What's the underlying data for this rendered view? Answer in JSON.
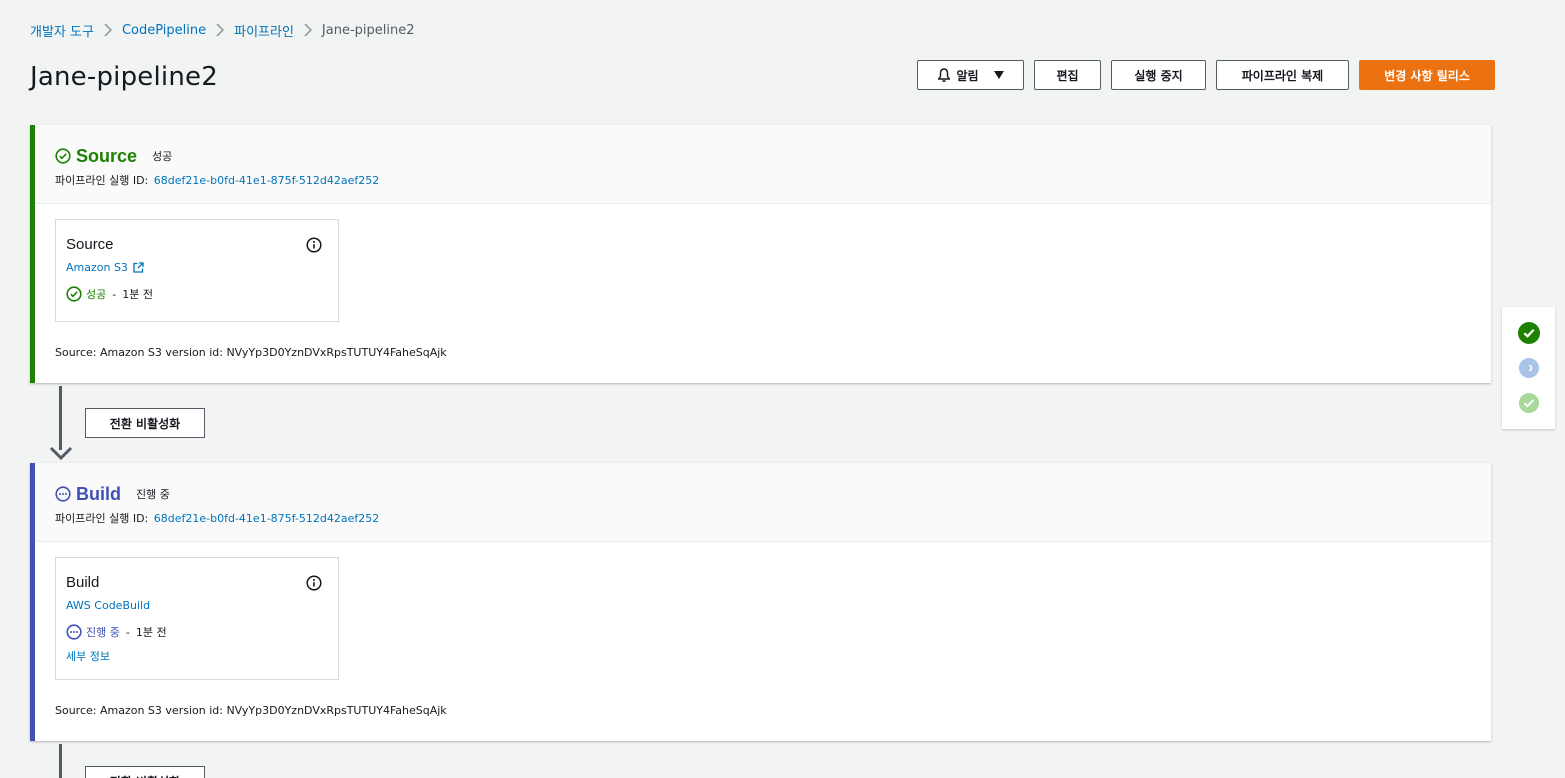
{
  "breadcrumb": {
    "items": [
      "개발자 도구",
      "CodePipeline",
      "파이프라인"
    ],
    "current": "Jane-pipeline2"
  },
  "page": {
    "title": "Jane-pipeline2"
  },
  "actions": {
    "notify": "알림",
    "edit": "편집",
    "stop": "실행 중지",
    "clone": "파이프라인 복제",
    "release": "변경 사항 릴리스"
  },
  "stages": [
    {
      "name": "Source",
      "status": "성공",
      "exec_label": "파이프라인 실행 ID:",
      "exec_id": "68def21e-b0fd-41e1-875f-512d42aef252",
      "action": {
        "name": "Source",
        "provider": "Amazon S3",
        "status": "성공",
        "time": "1분 전"
      },
      "revision": "Source: Amazon S3 version id: NVyYp3D0YznDVxRpsTUTUY4FaheSqAjk"
    },
    {
      "name": "Build",
      "status": "진행 중",
      "exec_label": "파이프라인 실행 ID:",
      "exec_id": "68def21e-b0fd-41e1-875f-512d42aef252",
      "action": {
        "name": "Build",
        "provider": "AWS CodeBuild",
        "status": "진행 중",
        "time": "1분 전",
        "details": "세부 정보"
      },
      "revision": "Source: Amazon S3 version id: NVyYp3D0YznDVxRpsTUTUY4FaheSqAjk"
    }
  ],
  "transition": {
    "label": "전환 비활성화"
  },
  "colors": {
    "success": "#1d8102",
    "progress": "#3f51b5",
    "link": "#0073bb",
    "primary": "#ec7211"
  },
  "icons": {
    "success": "check-circle-icon",
    "progress": "ellipsis-circle-icon",
    "info": "info-icon",
    "external": "external-link-icon",
    "bell": "bell-icon"
  }
}
